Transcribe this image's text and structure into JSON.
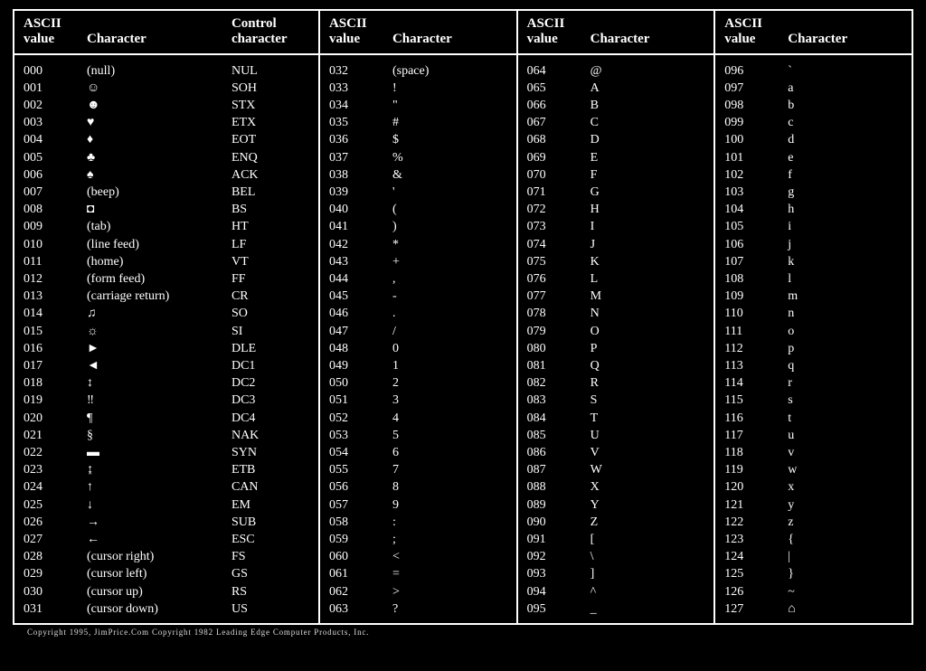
{
  "headers": {
    "ascii_value": "ASCII\nvalue",
    "character": "Character",
    "control_character": "Control\ncharacter"
  },
  "copyright": "Copyright 1995, JimPrice.Com   Copyright 1982 Leading Edge Computer Products, Inc.",
  "columns": [
    {
      "has_control": true,
      "rows": [
        {
          "v": "000",
          "ch": "(null)",
          "cc": "NUL"
        },
        {
          "v": "001",
          "ch": "☺",
          "cc": "SOH"
        },
        {
          "v": "002",
          "ch": "☻",
          "cc": "STX"
        },
        {
          "v": "003",
          "ch": "♥",
          "cc": "ETX"
        },
        {
          "v": "004",
          "ch": "♦",
          "cc": "EOT"
        },
        {
          "v": "005",
          "ch": "♣",
          "cc": "ENQ"
        },
        {
          "v": "006",
          "ch": "♠",
          "cc": "ACK"
        },
        {
          "v": "007",
          "ch": "(beep)",
          "cc": "BEL"
        },
        {
          "v": "008",
          "ch": "◘",
          "cc": "BS"
        },
        {
          "v": "009",
          "ch": "(tab)",
          "cc": "HT"
        },
        {
          "v": "010",
          "ch": "(line feed)",
          "cc": "LF"
        },
        {
          "v": "011",
          "ch": "(home)",
          "cc": "VT"
        },
        {
          "v": "012",
          "ch": "(form feed)",
          "cc": "FF"
        },
        {
          "v": "013",
          "ch": "(carriage return)",
          "cc": "CR"
        },
        {
          "v": "014",
          "ch": "♫",
          "cc": "SO"
        },
        {
          "v": "015",
          "ch": "☼",
          "cc": "SI"
        },
        {
          "v": "016",
          "ch": "►",
          "cc": "DLE"
        },
        {
          "v": "017",
          "ch": "◄",
          "cc": "DC1"
        },
        {
          "v": "018",
          "ch": "↕",
          "cc": "DC2"
        },
        {
          "v": "019",
          "ch": "‼",
          "cc": "DC3"
        },
        {
          "v": "020",
          "ch": "¶",
          "cc": "DC4"
        },
        {
          "v": "021",
          "ch": "§",
          "cc": "NAK"
        },
        {
          "v": "022",
          "ch": "▬",
          "cc": "SYN"
        },
        {
          "v": "023",
          "ch": "↨",
          "cc": "ETB"
        },
        {
          "v": "024",
          "ch": "↑",
          "cc": "CAN"
        },
        {
          "v": "025",
          "ch": "↓",
          "cc": "EM"
        },
        {
          "v": "026",
          "ch": "→",
          "cc": "SUB"
        },
        {
          "v": "027",
          "ch": "←",
          "cc": "ESC"
        },
        {
          "v": "028",
          "ch": "(cursor right)",
          "cc": "FS"
        },
        {
          "v": "029",
          "ch": "(cursor left)",
          "cc": "GS"
        },
        {
          "v": "030",
          "ch": "(cursor up)",
          "cc": "RS"
        },
        {
          "v": "031",
          "ch": "(cursor down)",
          "cc": "US"
        }
      ]
    },
    {
      "has_control": false,
      "rows": [
        {
          "v": "032",
          "ch": "(space)"
        },
        {
          "v": "033",
          "ch": "!"
        },
        {
          "v": "034",
          "ch": "\""
        },
        {
          "v": "035",
          "ch": "#"
        },
        {
          "v": "036",
          "ch": "$"
        },
        {
          "v": "037",
          "ch": "%"
        },
        {
          "v": "038",
          "ch": "&"
        },
        {
          "v": "039",
          "ch": "'"
        },
        {
          "v": "040",
          "ch": "("
        },
        {
          "v": "041",
          "ch": ")"
        },
        {
          "v": "042",
          "ch": "*"
        },
        {
          "v": "043",
          "ch": "+"
        },
        {
          "v": "044",
          "ch": ","
        },
        {
          "v": "045",
          "ch": "-"
        },
        {
          "v": "046",
          "ch": "."
        },
        {
          "v": "047",
          "ch": "/"
        },
        {
          "v": "048",
          "ch": "0"
        },
        {
          "v": "049",
          "ch": "1"
        },
        {
          "v": "050",
          "ch": "2"
        },
        {
          "v": "051",
          "ch": "3"
        },
        {
          "v": "052",
          "ch": "4"
        },
        {
          "v": "053",
          "ch": "5"
        },
        {
          "v": "054",
          "ch": "6"
        },
        {
          "v": "055",
          "ch": "7"
        },
        {
          "v": "056",
          "ch": "8"
        },
        {
          "v": "057",
          "ch": "9"
        },
        {
          "v": "058",
          "ch": ":"
        },
        {
          "v": "059",
          "ch": ";"
        },
        {
          "v": "060",
          "ch": "<"
        },
        {
          "v": "061",
          "ch": "="
        },
        {
          "v": "062",
          "ch": ">"
        },
        {
          "v": "063",
          "ch": "?"
        }
      ]
    },
    {
      "has_control": false,
      "rows": [
        {
          "v": "064",
          "ch": "@"
        },
        {
          "v": "065",
          "ch": "A"
        },
        {
          "v": "066",
          "ch": "B"
        },
        {
          "v": "067",
          "ch": "C"
        },
        {
          "v": "068",
          "ch": "D"
        },
        {
          "v": "069",
          "ch": "E"
        },
        {
          "v": "070",
          "ch": "F"
        },
        {
          "v": "071",
          "ch": "G"
        },
        {
          "v": "072",
          "ch": "H"
        },
        {
          "v": "073",
          "ch": "I"
        },
        {
          "v": "074",
          "ch": "J"
        },
        {
          "v": "075",
          "ch": "K"
        },
        {
          "v": "076",
          "ch": "L"
        },
        {
          "v": "077",
          "ch": "M"
        },
        {
          "v": "078",
          "ch": "N"
        },
        {
          "v": "079",
          "ch": "O"
        },
        {
          "v": "080",
          "ch": "P"
        },
        {
          "v": "081",
          "ch": "Q"
        },
        {
          "v": "082",
          "ch": "R"
        },
        {
          "v": "083",
          "ch": "S"
        },
        {
          "v": "084",
          "ch": "T"
        },
        {
          "v": "085",
          "ch": "U"
        },
        {
          "v": "086",
          "ch": "V"
        },
        {
          "v": "087",
          "ch": "W"
        },
        {
          "v": "088",
          "ch": "X"
        },
        {
          "v": "089",
          "ch": "Y"
        },
        {
          "v": "090",
          "ch": "Z"
        },
        {
          "v": "091",
          "ch": "["
        },
        {
          "v": "092",
          "ch": "\\"
        },
        {
          "v": "093",
          "ch": "]"
        },
        {
          "v": "094",
          "ch": "^"
        },
        {
          "v": "095",
          "ch": "_"
        }
      ]
    },
    {
      "has_control": false,
      "rows": [
        {
          "v": "096",
          "ch": "`"
        },
        {
          "v": "097",
          "ch": "a"
        },
        {
          "v": "098",
          "ch": "b"
        },
        {
          "v": "099",
          "ch": "c"
        },
        {
          "v": "100",
          "ch": "d"
        },
        {
          "v": "101",
          "ch": "e"
        },
        {
          "v": "102",
          "ch": "f"
        },
        {
          "v": "103",
          "ch": "g"
        },
        {
          "v": "104",
          "ch": "h"
        },
        {
          "v": "105",
          "ch": "i"
        },
        {
          "v": "106",
          "ch": "j"
        },
        {
          "v": "107",
          "ch": "k"
        },
        {
          "v": "108",
          "ch": "l"
        },
        {
          "v": "109",
          "ch": "m"
        },
        {
          "v": "110",
          "ch": "n"
        },
        {
          "v": "111",
          "ch": "o"
        },
        {
          "v": "112",
          "ch": "p"
        },
        {
          "v": "113",
          "ch": "q"
        },
        {
          "v": "114",
          "ch": "r"
        },
        {
          "v": "115",
          "ch": "s"
        },
        {
          "v": "116",
          "ch": "t"
        },
        {
          "v": "117",
          "ch": "u"
        },
        {
          "v": "118",
          "ch": "v"
        },
        {
          "v": "119",
          "ch": "w"
        },
        {
          "v": "120",
          "ch": "x"
        },
        {
          "v": "121",
          "ch": "y"
        },
        {
          "v": "122",
          "ch": "z"
        },
        {
          "v": "123",
          "ch": "{"
        },
        {
          "v": "124",
          "ch": "|"
        },
        {
          "v": "125",
          "ch": "}"
        },
        {
          "v": "126",
          "ch": "~"
        },
        {
          "v": "127",
          "ch": "⌂"
        }
      ]
    }
  ]
}
